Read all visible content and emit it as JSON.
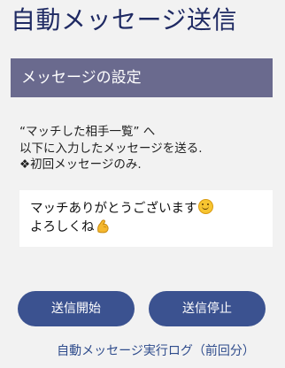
{
  "page": {
    "title": "自動メッセージ送信"
  },
  "settings_section": {
    "header": "メッセージの設定"
  },
  "description": {
    "line1": "“マッチした相手一覧” へ",
    "line2": "以下に入力したメッセージを送る.",
    "line3": "❖初回メッセージのみ."
  },
  "message": {
    "line1_text": "マッチありがとうございます",
    "line1_emoji": "smiling-face-emoji",
    "line2_text": "よろしくね",
    "line2_emoji": "flexed-biceps-emoji"
  },
  "buttons": {
    "start_label": "送信開始",
    "stop_label": "送信停止"
  },
  "log_link": {
    "label": "自動メッセージ実行ログ（前回分）"
  },
  "colors": {
    "title": "#1f2a63",
    "section_header_bg": "#6a6a8e",
    "button_bg": "#3b5290",
    "link": "#2f4c8c",
    "page_bg": "#f2f2f2"
  }
}
